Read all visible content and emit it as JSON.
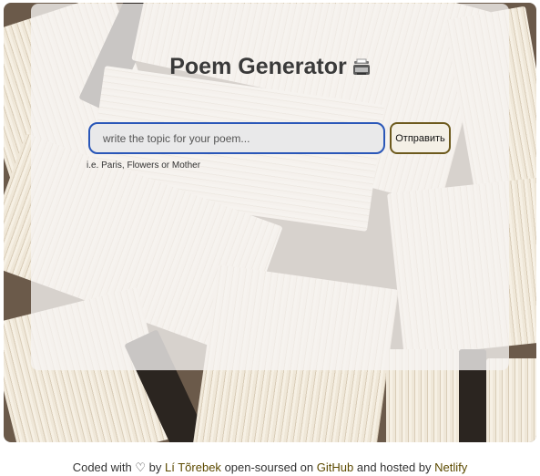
{
  "app": {
    "title": "Poem Generator",
    "title_icon": "typewriter-icon"
  },
  "form": {
    "input_placeholder": "write the topic for your poem...",
    "input_value": "",
    "submit_label": "Отправить",
    "hint": "i.e. Paris, Flowers or Mother"
  },
  "footer": {
    "coded_with": "Coded with",
    "heart": "♡",
    "by": "by",
    "author": "Lí Tõrebek",
    "open_sourced_on": "open-soursed on",
    "github": "GitHub",
    "hosted_by": "and hosted by",
    "netlify": "Netlify"
  },
  "colors": {
    "input_border": "#2a57b8",
    "button_border": "#6d5a1d",
    "link": "#5c4a00"
  }
}
